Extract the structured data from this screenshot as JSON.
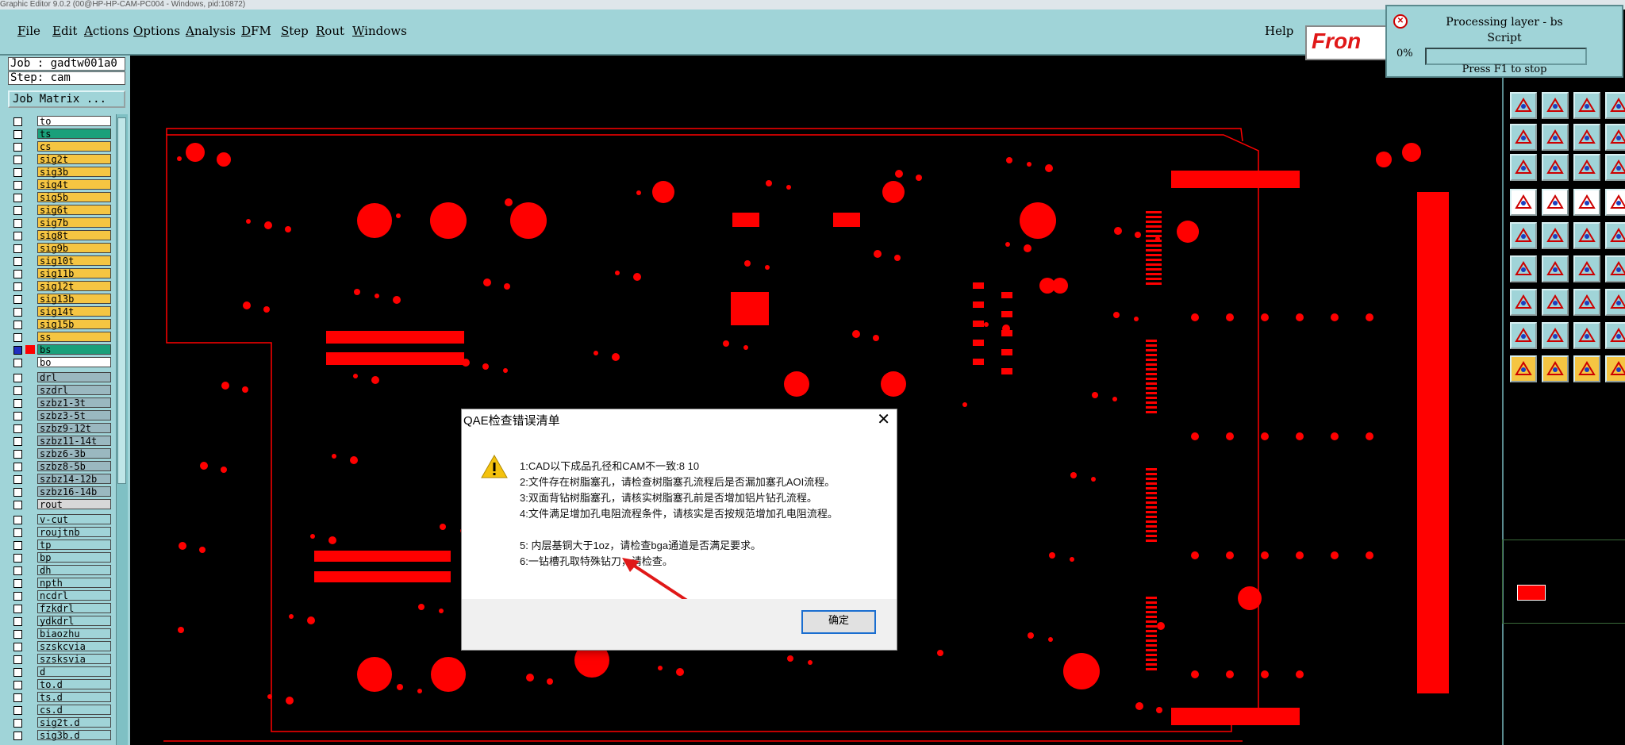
{
  "titlebar": {
    "text": "Graphic Editor 9.0.2 (00@HP-HP-CAM-PC004 - Windows, pid:10872)"
  },
  "menu": [
    "File",
    "Edit",
    "Actions",
    "Options",
    "Analysis",
    "DFM",
    "Step",
    "Rout",
    "Windows"
  ],
  "help_label": "Help",
  "logo_text": "Fron",
  "processing": {
    "title": "Processing layer - bs",
    "subtitle": "Script",
    "percent": "0%",
    "progress": 0,
    "hint": "Press F1 to stop"
  },
  "job": {
    "job_line": "Job : gadtw001a0",
    "step_line": "Step: cam",
    "matrix_button": "Job Matrix ..."
  },
  "layers": [
    {
      "name": "to",
      "color": "#ffffff"
    },
    {
      "name": "ts",
      "color": "#1aa07a"
    },
    {
      "name": "cs",
      "color": "#f5c542"
    },
    {
      "name": "sig2t",
      "color": "#f5c542"
    },
    {
      "name": "sig3b",
      "color": "#f5c542"
    },
    {
      "name": "sig4t",
      "color": "#f5c542"
    },
    {
      "name": "sig5b",
      "color": "#f5c542"
    },
    {
      "name": "sig6t",
      "color": "#f5c542"
    },
    {
      "name": "sig7b",
      "color": "#f5c542"
    },
    {
      "name": "sig8t",
      "color": "#f5c542"
    },
    {
      "name": "sig9b",
      "color": "#f5c542"
    },
    {
      "name": "sig10t",
      "color": "#f5c542"
    },
    {
      "name": "sig11b",
      "color": "#f5c542"
    },
    {
      "name": "sig12t",
      "color": "#f5c542"
    },
    {
      "name": "sig13b",
      "color": "#f5c542"
    },
    {
      "name": "sig14t",
      "color": "#f5c542"
    },
    {
      "name": "sig15b",
      "color": "#f5c542"
    },
    {
      "name": "ss",
      "color": "#f5c542"
    },
    {
      "name": "bs",
      "color": "#1aa07a",
      "active": true
    },
    {
      "name": "bo",
      "color": "#ffffff"
    },
    {
      "name": "drl",
      "color": "#9ab8c0",
      "gap": true
    },
    {
      "name": "szdrl",
      "color": "#9ab8c0"
    },
    {
      "name": "szbz1-3t",
      "color": "#9ab8c0"
    },
    {
      "name": "szbz3-5t",
      "color": "#9ab8c0"
    },
    {
      "name": "szbz9-12t",
      "color": "#9ab8c0"
    },
    {
      "name": "szbz11-14t",
      "color": "#9ab8c0"
    },
    {
      "name": "szbz6-3b",
      "color": "#9ab8c0"
    },
    {
      "name": "szbz8-5b",
      "color": "#9ab8c0"
    },
    {
      "name": "szbz14-12b",
      "color": "#9ab8c0"
    },
    {
      "name": "szbz16-14b",
      "color": "#9ab8c0"
    },
    {
      "name": "rout",
      "color": "#d8d8d8"
    },
    {
      "name": "v-cut",
      "color": "#a0d4d8",
      "gap": true
    },
    {
      "name": "roujtnb",
      "color": "#a0d4d8"
    },
    {
      "name": "tp",
      "color": "#a0d4d8"
    },
    {
      "name": "bp",
      "color": "#a0d4d8"
    },
    {
      "name": "dh",
      "color": "#a0d4d8"
    },
    {
      "name": "npth",
      "color": "#a0d4d8"
    },
    {
      "name": "ncdrl",
      "color": "#a0d4d8"
    },
    {
      "name": "fzkdrl",
      "color": "#a0d4d8"
    },
    {
      "name": "ydkdrl",
      "color": "#a0d4d8"
    },
    {
      "name": "biaozhu",
      "color": "#a0d4d8"
    },
    {
      "name": "szskcvia",
      "color": "#a0d4d8"
    },
    {
      "name": "szsksvia",
      "color": "#a0d4d8"
    },
    {
      "name": "d",
      "color": "#a0d4d8"
    },
    {
      "name": "to.d",
      "color": "#a0d4d8"
    },
    {
      "name": "ts.d",
      "color": "#a0d4d8"
    },
    {
      "name": "cs.d",
      "color": "#a0d4d8"
    },
    {
      "name": "sig2t.d",
      "color": "#a0d4d8"
    },
    {
      "name": "sig3b.d",
      "color": "#a0d4d8"
    }
  ],
  "dialog": {
    "title": "QAE检查错误清单",
    "close": "✕",
    "lines": [
      "1:CAD以下成品孔径和CAM不一致:8 10",
      "2:文件存在树脂塞孔，请检查树脂塞孔流程后是否漏加塞孔AOI流程。",
      "3:双面背钻树脂塞孔，请核实树脂塞孔前是否增加铝片钻孔流程。",
      "4:文件满足增加孔电阻流程条件，请核实是否按规范增加孔电阻流程。",
      "",
      "5: 内层基铜大于1oz，请检查bga通道是否满足要求。",
      "6:一钻槽孔取特殊钻刀，请检查。"
    ],
    "ok_label": "确定"
  },
  "colors": {
    "ui": "#a0d4d8",
    "copper": "#ff0000",
    "background": "#000000"
  }
}
